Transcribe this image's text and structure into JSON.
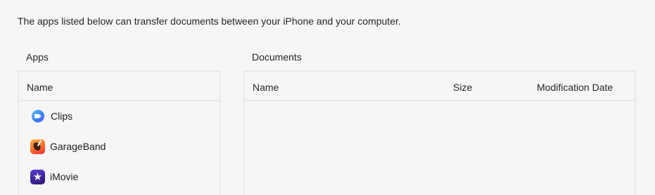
{
  "intro_text": "The apps listed below can transfer documents between your iPhone and your computer.",
  "apps_section": {
    "label": "Apps",
    "column_name": "Name",
    "items": [
      {
        "label": "Clips",
        "icon": "clips-icon"
      },
      {
        "label": "GarageBand",
        "icon": "garageband-icon"
      },
      {
        "label": "iMovie",
        "icon": "imovie-icon"
      }
    ]
  },
  "documents_section": {
    "label": "Documents",
    "columns": {
      "name": "Name",
      "size": "Size",
      "modification_date": "Modification Date"
    },
    "rows": []
  },
  "colors": {
    "background": "#f6f6f6",
    "border": "#e9e9e9",
    "text": "#1d1d1f"
  }
}
